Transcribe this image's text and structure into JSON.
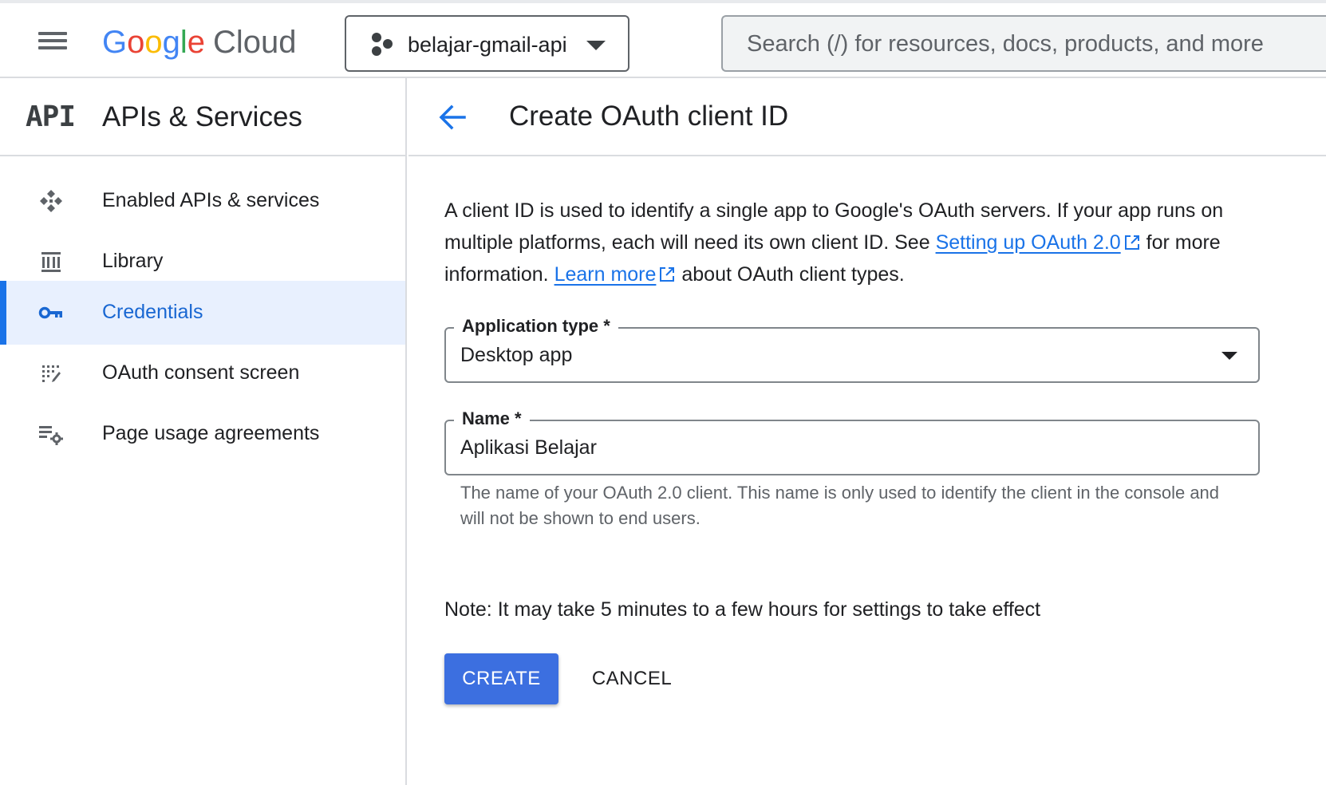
{
  "topbar": {
    "logo_google": [
      "G",
      "o",
      "o",
      "g",
      "l",
      "e"
    ],
    "logo_product": "Cloud",
    "project_name": "belajar-gmail-api",
    "search_placeholder": "Search (/) for resources, docs, products, and more"
  },
  "sidebar": {
    "icon_text": "API",
    "title": "APIs & Services",
    "items": [
      {
        "label": "Enabled APIs & services",
        "icon": "enabled-apis-icon"
      },
      {
        "label": "Library",
        "icon": "library-icon"
      },
      {
        "label": "Credentials",
        "icon": "key-icon",
        "active": true
      },
      {
        "label": "OAuth consent screen",
        "icon": "consent-screen-icon"
      },
      {
        "label": "Page usage agreements",
        "icon": "settings-list-icon"
      }
    ]
  },
  "main": {
    "title": "Create OAuth client ID",
    "intro": {
      "part1": "A client ID is used to identify a single app to Google's OAuth servers. If your app runs on multiple platforms, each will need its own client ID. See ",
      "link1": "Setting up OAuth 2.0",
      "part2": " for more information. ",
      "link2": "Learn more",
      "part3": " about OAuth client types."
    },
    "application_type": {
      "label": "Application type *",
      "value": "Desktop app"
    },
    "name_field": {
      "label": "Name *",
      "value": "Aplikasi Belajar"
    },
    "name_hint": "The name of your OAuth 2.0 client. This name is only used to identify the client in the console and will not be shown to end users.",
    "note": "Note: It may take 5 minutes to a few hours for settings to take effect",
    "create_label": "CREATE",
    "cancel_label": "CANCEL"
  },
  "colors": {
    "accent": "#1a73e8",
    "create_button": "#3c6fe0",
    "active_nav_bg": "#e8f0fe"
  }
}
